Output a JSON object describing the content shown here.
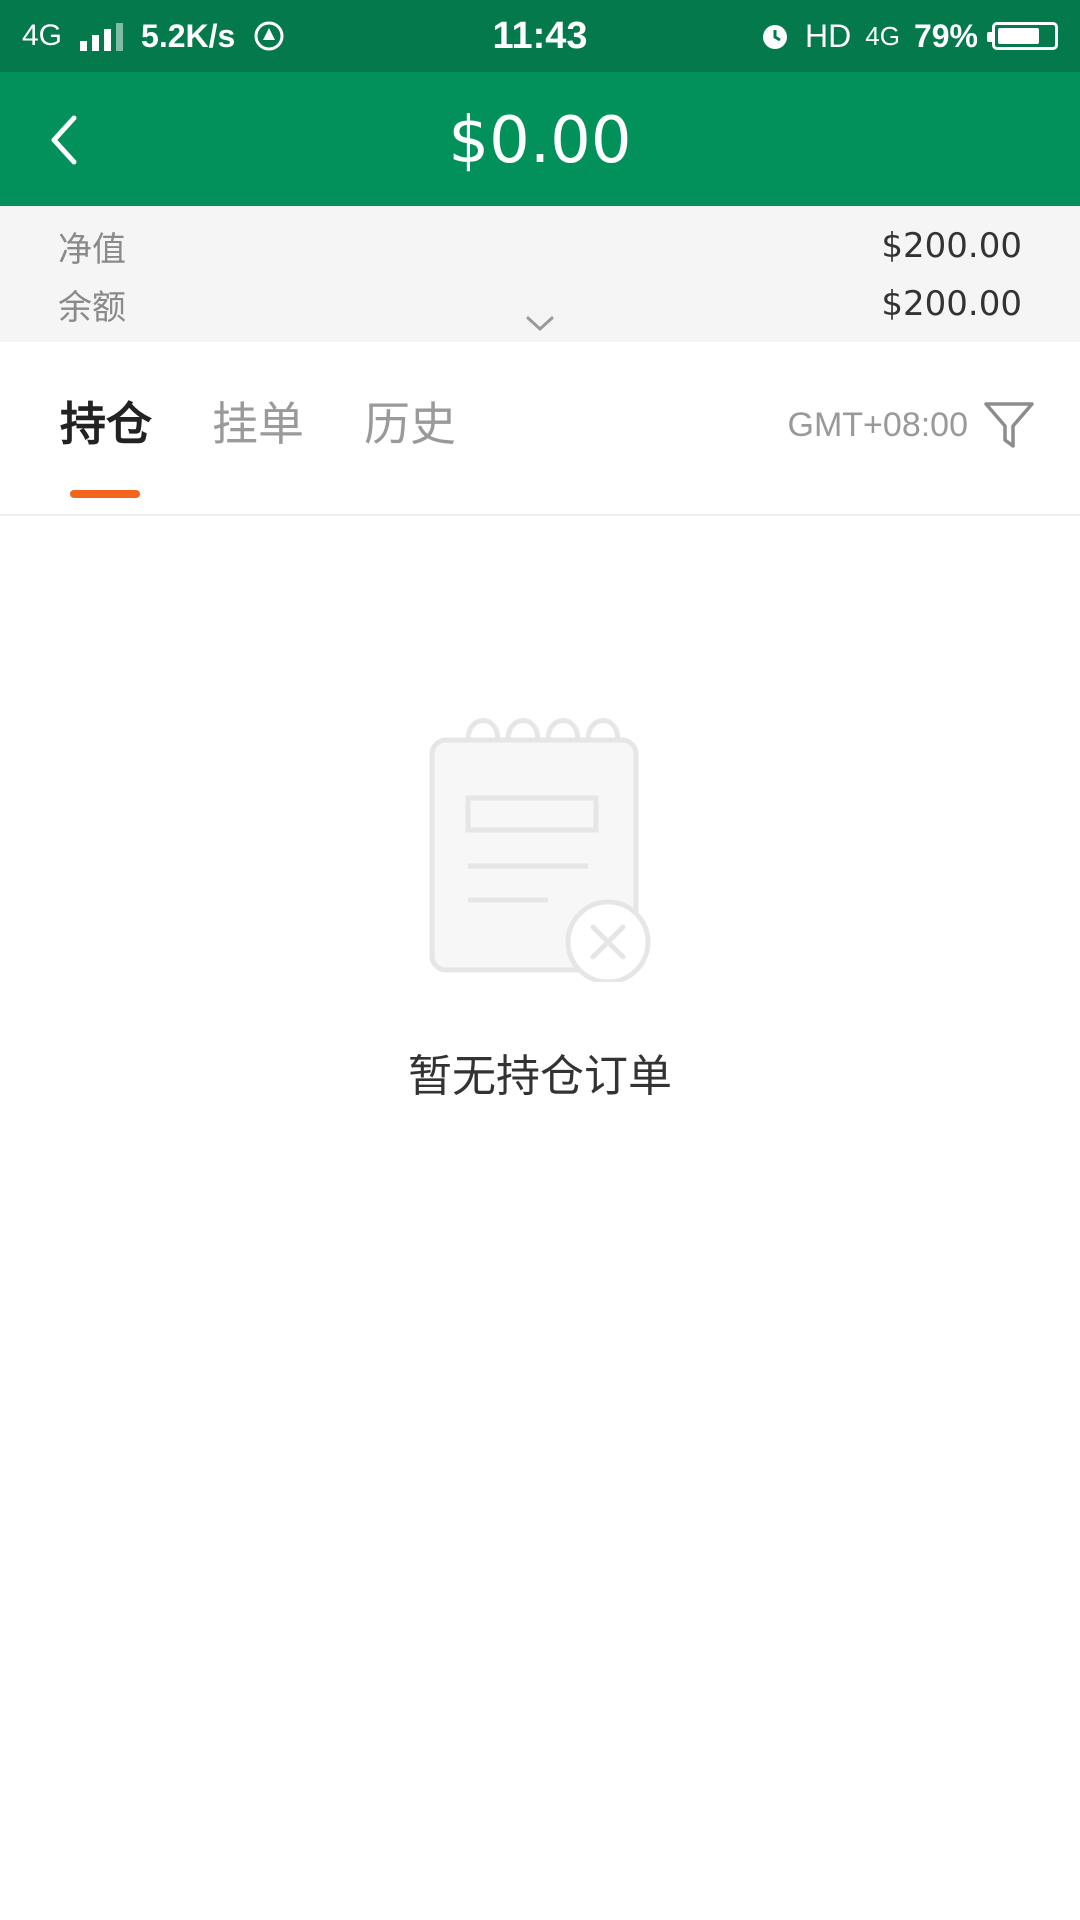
{
  "status_bar": {
    "network_type": "4G",
    "speed": "5.2K/s",
    "time": "11:43",
    "hd_label": "HD",
    "lte_label": "4G",
    "battery_percent_text": "79%",
    "battery_level": 0.79,
    "icons": [
      "signal-icon",
      "notification-app-icon",
      "alarm-icon",
      "battery-icon"
    ]
  },
  "header": {
    "title": "$0.00",
    "back_icon": "chevron-left-icon",
    "background_color": "#02915b"
  },
  "summary": {
    "rows": [
      {
        "label": "净值",
        "value": "$200.00"
      },
      {
        "label": "余额",
        "value": "$200.00"
      }
    ],
    "expand_icon": "chevron-down-icon"
  },
  "tabs": {
    "items": [
      {
        "label": "持仓",
        "active": true
      },
      {
        "label": "挂单",
        "active": false
      },
      {
        "label": "历史",
        "active": false
      }
    ],
    "timezone": "GMT+08:00",
    "filter_icon": "filter-icon",
    "accent_color": "#f3651c"
  },
  "empty_state": {
    "icon": "empty-notepad-icon",
    "message": "暂无持仓订单"
  }
}
